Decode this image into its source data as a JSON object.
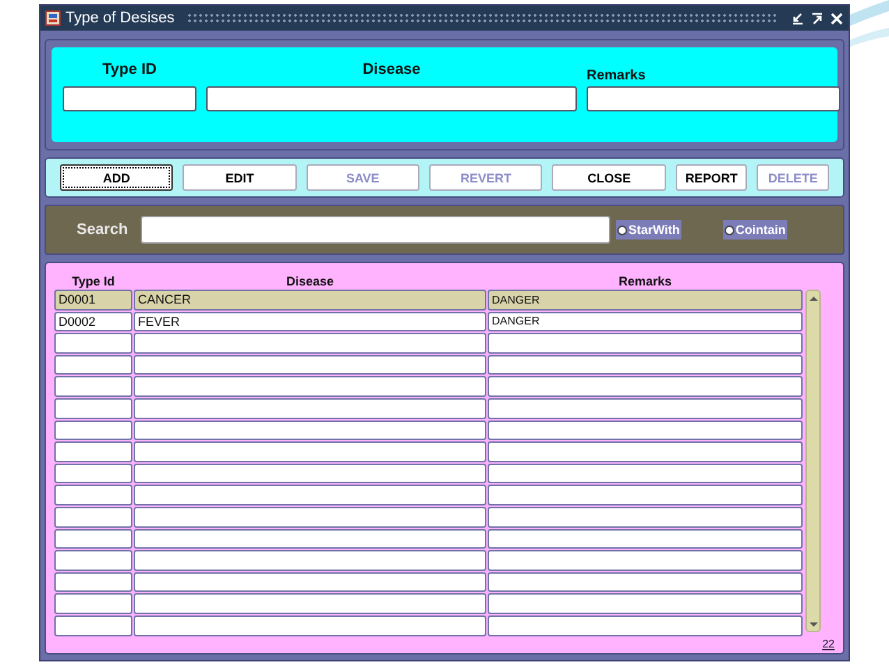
{
  "window": {
    "title": "Type of Desises"
  },
  "entry_form": {
    "fields": [
      {
        "label": "Type ID"
      },
      {
        "label": "Disease"
      },
      {
        "label": "Remarks"
      }
    ]
  },
  "buttons": [
    {
      "label": "ADD",
      "disabled": false,
      "focused": true
    },
    {
      "label": "EDIT",
      "disabled": false,
      "focused": false
    },
    {
      "label": "SAVE",
      "disabled": true,
      "focused": false
    },
    {
      "label": "REVERT",
      "disabled": true,
      "focused": false
    },
    {
      "label": "CLOSE",
      "disabled": false,
      "focused": false
    },
    {
      "label": "REPORT",
      "disabled": false,
      "focused": false
    },
    {
      "label": "DELETE",
      "disabled": true,
      "focused": false
    }
  ],
  "search": {
    "label": "Search",
    "options": [
      {
        "label": "StarWith",
        "selected": false
      },
      {
        "label": "Cointain",
        "selected": false
      }
    ]
  },
  "table": {
    "columns": [
      "Type Id",
      "Disease",
      "Remarks"
    ],
    "rows": [
      {
        "type_id": "D0001",
        "disease": "CANCER",
        "remarks": "DANGER",
        "selected": true
      },
      {
        "type_id": "D0002",
        "disease": "FEVER",
        "remarks": "DANGER",
        "selected": false
      },
      {
        "selected": false
      },
      {
        "selected": false
      },
      {
        "selected": false
      },
      {
        "selected": false
      },
      {
        "selected": false
      },
      {
        "selected": false
      },
      {
        "selected": false
      },
      {
        "selected": false
      },
      {
        "selected": false
      },
      {
        "selected": false
      },
      {
        "selected": false
      },
      {
        "selected": false
      },
      {
        "selected": false
      },
      {
        "selected": false
      }
    ]
  },
  "slide_number": "22"
}
